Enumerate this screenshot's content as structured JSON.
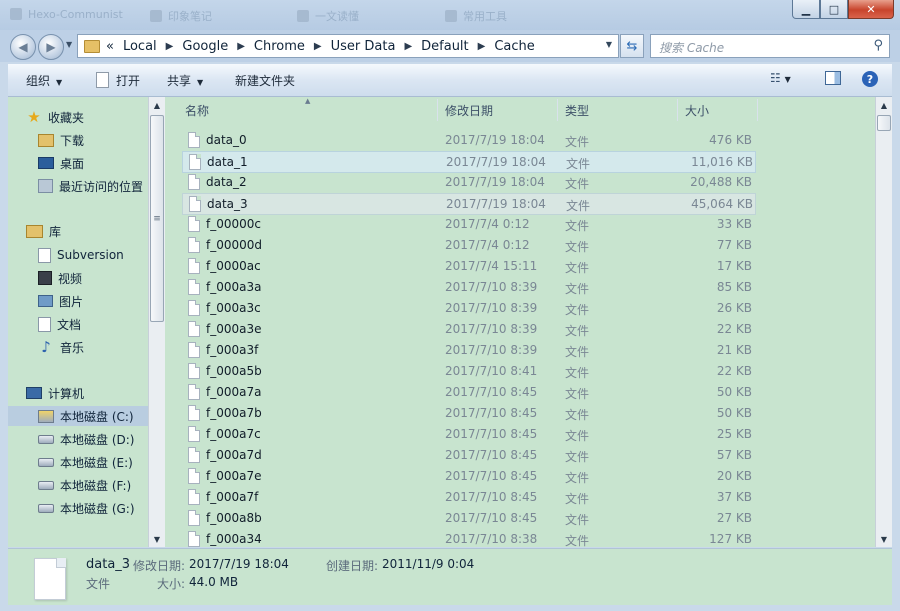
{
  "window": {
    "ghost_tabs": [
      "Hexo-Communist",
      "印象笔记",
      "一文读懂",
      "常用工具"
    ],
    "minimize": "▁",
    "maximize": "□",
    "close": "✕"
  },
  "address": {
    "prefix": "«",
    "breadcrumbs": [
      "Local",
      "Google",
      "Chrome",
      "User Data",
      "Default",
      "Cache"
    ],
    "search_placeholder": "搜索 Cache"
  },
  "toolbar": {
    "organize": "组织",
    "open": "打开",
    "share": "共享",
    "new_folder": "新建文件夹"
  },
  "sidebar": {
    "favorites": {
      "label": "收藏夹",
      "items": [
        "下载",
        "桌面",
        "最近访问的位置"
      ]
    },
    "libraries": {
      "label": "库",
      "items": [
        "Subversion",
        "视频",
        "图片",
        "文档",
        "音乐"
      ]
    },
    "computer": {
      "label": "计算机",
      "items": [
        "本地磁盘 (C:)",
        "本地磁盘 (D:)",
        "本地磁盘 (E:)",
        "本地磁盘 (F:)",
        "本地磁盘 (G:)"
      ]
    }
  },
  "columns": {
    "name": "名称",
    "date": "修改日期",
    "type": "类型",
    "size": "大小"
  },
  "files": [
    {
      "name": "data_0",
      "date": "2017/7/19 18:04",
      "type": "文件",
      "size": "476 KB"
    },
    {
      "name": "data_1",
      "date": "2017/7/19 18:04",
      "type": "文件",
      "size": "11,016 KB"
    },
    {
      "name": "data_2",
      "date": "2017/7/19 18:04",
      "type": "文件",
      "size": "20,488 KB"
    },
    {
      "name": "data_3",
      "date": "2017/7/19 18:04",
      "type": "文件",
      "size": "45,064 KB"
    },
    {
      "name": "f_00000c",
      "date": "2017/7/4 0:12",
      "type": "文件",
      "size": "33 KB"
    },
    {
      "name": "f_00000d",
      "date": "2017/7/4 0:12",
      "type": "文件",
      "size": "77 KB"
    },
    {
      "name": "f_0000ac",
      "date": "2017/7/4 15:11",
      "type": "文件",
      "size": "17 KB"
    },
    {
      "name": "f_000a3a",
      "date": "2017/7/10 8:39",
      "type": "文件",
      "size": "85 KB"
    },
    {
      "name": "f_000a3c",
      "date": "2017/7/10 8:39",
      "type": "文件",
      "size": "26 KB"
    },
    {
      "name": "f_000a3e",
      "date": "2017/7/10 8:39",
      "type": "文件",
      "size": "22 KB"
    },
    {
      "name": "f_000a3f",
      "date": "2017/7/10 8:39",
      "type": "文件",
      "size": "21 KB"
    },
    {
      "name": "f_000a5b",
      "date": "2017/7/10 8:41",
      "type": "文件",
      "size": "22 KB"
    },
    {
      "name": "f_000a7a",
      "date": "2017/7/10 8:45",
      "type": "文件",
      "size": "50 KB"
    },
    {
      "name": "f_000a7b",
      "date": "2017/7/10 8:45",
      "type": "文件",
      "size": "50 KB"
    },
    {
      "name": "f_000a7c",
      "date": "2017/7/10 8:45",
      "type": "文件",
      "size": "25 KB"
    },
    {
      "name": "f_000a7d",
      "date": "2017/7/10 8:45",
      "type": "文件",
      "size": "57 KB"
    },
    {
      "name": "f_000a7e",
      "date": "2017/7/10 8:45",
      "type": "文件",
      "size": "20 KB"
    },
    {
      "name": "f_000a7f",
      "date": "2017/7/10 8:45",
      "type": "文件",
      "size": "37 KB"
    },
    {
      "name": "f_000a8b",
      "date": "2017/7/10 8:45",
      "type": "文件",
      "size": "27 KB"
    },
    {
      "name": "f_000a34",
      "date": "2017/7/10 8:38",
      "type": "文件",
      "size": "127 KB"
    }
  ],
  "hovered_file": "data_1",
  "selected_file": "data_3",
  "details": {
    "name": "data_3",
    "type": "文件",
    "modified_label": "修改日期:",
    "modified_value": "2017/7/19 18:04",
    "created_label": "创建日期:",
    "created_value": "2011/11/9 0:04",
    "size_label": "大小:",
    "size_value": "44.0 MB"
  },
  "colors": {
    "pane_bg": "#c8e4cf",
    "chrome_bg": "#c9d9ea",
    "close_red": "#c8442c"
  }
}
